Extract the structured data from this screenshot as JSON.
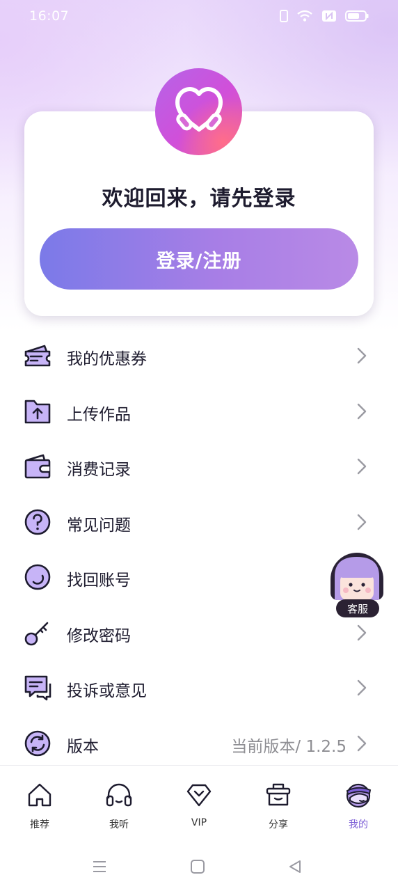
{
  "status_bar": {
    "time": "16:07"
  },
  "login_card": {
    "welcome_text": "欢迎回来，请先登录",
    "login_button": "登录/注册"
  },
  "menu": {
    "items": [
      {
        "label": "我的优惠券",
        "icon": "coupon-icon"
      },
      {
        "label": "上传作品",
        "icon": "upload-folder-icon"
      },
      {
        "label": "消费记录",
        "icon": "wallet-icon"
      },
      {
        "label": "常见问题",
        "icon": "question-icon"
      },
      {
        "label": "找回账号",
        "icon": "recover-account-icon"
      },
      {
        "label": "修改密码",
        "icon": "key-icon"
      },
      {
        "label": "投诉或意见",
        "icon": "feedback-icon"
      },
      {
        "label": "版本",
        "icon": "refresh-icon",
        "value": "当前版本/ 1.2.5"
      }
    ]
  },
  "support": {
    "label": "客服"
  },
  "tabbar": {
    "tabs": [
      {
        "label": "推荐",
        "icon": "home-icon"
      },
      {
        "label": "我听",
        "icon": "headphones-icon"
      },
      {
        "label": "VIP",
        "icon": "diamond-icon"
      },
      {
        "label": "分享",
        "icon": "share-basket-icon"
      },
      {
        "label": "我的",
        "icon": "profile-avatar-icon",
        "active": true
      }
    ]
  },
  "colors": {
    "accent": "#7d5fd6",
    "icon_fill": "#c7b4f7",
    "icon_stroke": "#1d1b2e",
    "button_start": "#7b7ae8",
    "button_end": "#b98ae6"
  }
}
